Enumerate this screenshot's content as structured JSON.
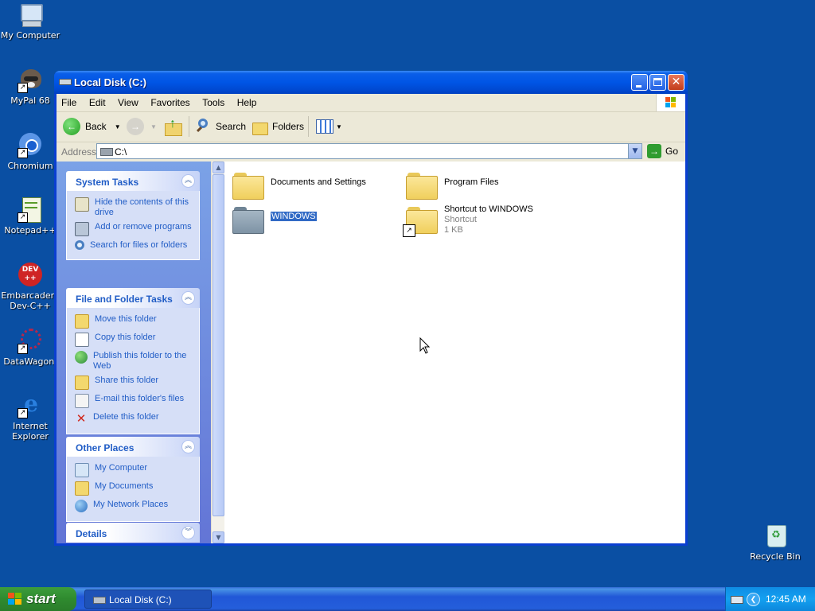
{
  "desktop": {
    "icons": [
      {
        "label": "My Computer"
      },
      {
        "label": "MyPal 68"
      },
      {
        "label": "Chromium"
      },
      {
        "label": "Notepad++"
      },
      {
        "label": "Embarcadero Dev-C++"
      },
      {
        "label": "DataWagon."
      },
      {
        "label": "Internet Explorer"
      },
      {
        "label": "Recycle Bin"
      }
    ]
  },
  "window": {
    "title": "Local Disk (C:)",
    "menu": [
      "File",
      "Edit",
      "View",
      "Favorites",
      "Tools",
      "Help"
    ],
    "toolbar": {
      "back": "Back",
      "search": "Search",
      "folders": "Folders"
    },
    "address": {
      "label": "Address",
      "value": "C:\\",
      "go": "Go"
    }
  },
  "leftpane": {
    "system_tasks": {
      "title": "System Tasks",
      "items": [
        {
          "label": "Hide the contents of this drive",
          "icon": "hide-drive-icon"
        },
        {
          "label": "Add or remove programs",
          "icon": "add-remove-icon"
        },
        {
          "label": "Search for files or folders",
          "icon": "search-icon"
        }
      ]
    },
    "file_folder_tasks": {
      "title": "File and Folder Tasks",
      "items": [
        {
          "label": "Move this folder"
        },
        {
          "label": "Copy this folder"
        },
        {
          "label": "Publish this folder to the Web"
        },
        {
          "label": "Share this folder"
        },
        {
          "label": "E-mail this folder's files"
        },
        {
          "label": "Delete this folder"
        }
      ]
    },
    "other_places": {
      "title": "Other Places",
      "items": [
        {
          "label": "My Computer"
        },
        {
          "label": "My Documents"
        },
        {
          "label": "My Network Places"
        }
      ]
    },
    "details": {
      "title": "Details"
    }
  },
  "content": {
    "items": [
      {
        "name": "Documents and Settings"
      },
      {
        "name": "Program Files"
      },
      {
        "name": "WINDOWS"
      },
      {
        "name": "Shortcut to WINDOWS",
        "type": "Shortcut",
        "size": "1 KB"
      }
    ]
  },
  "taskbar": {
    "start": "start",
    "task": "Local Disk (C:)",
    "clock": "12:45 AM"
  },
  "colors": {
    "desktop": "#0a4fa3",
    "title_bar": "#0055e5",
    "task_link": "#215dc6",
    "selection": "#316ac5"
  }
}
